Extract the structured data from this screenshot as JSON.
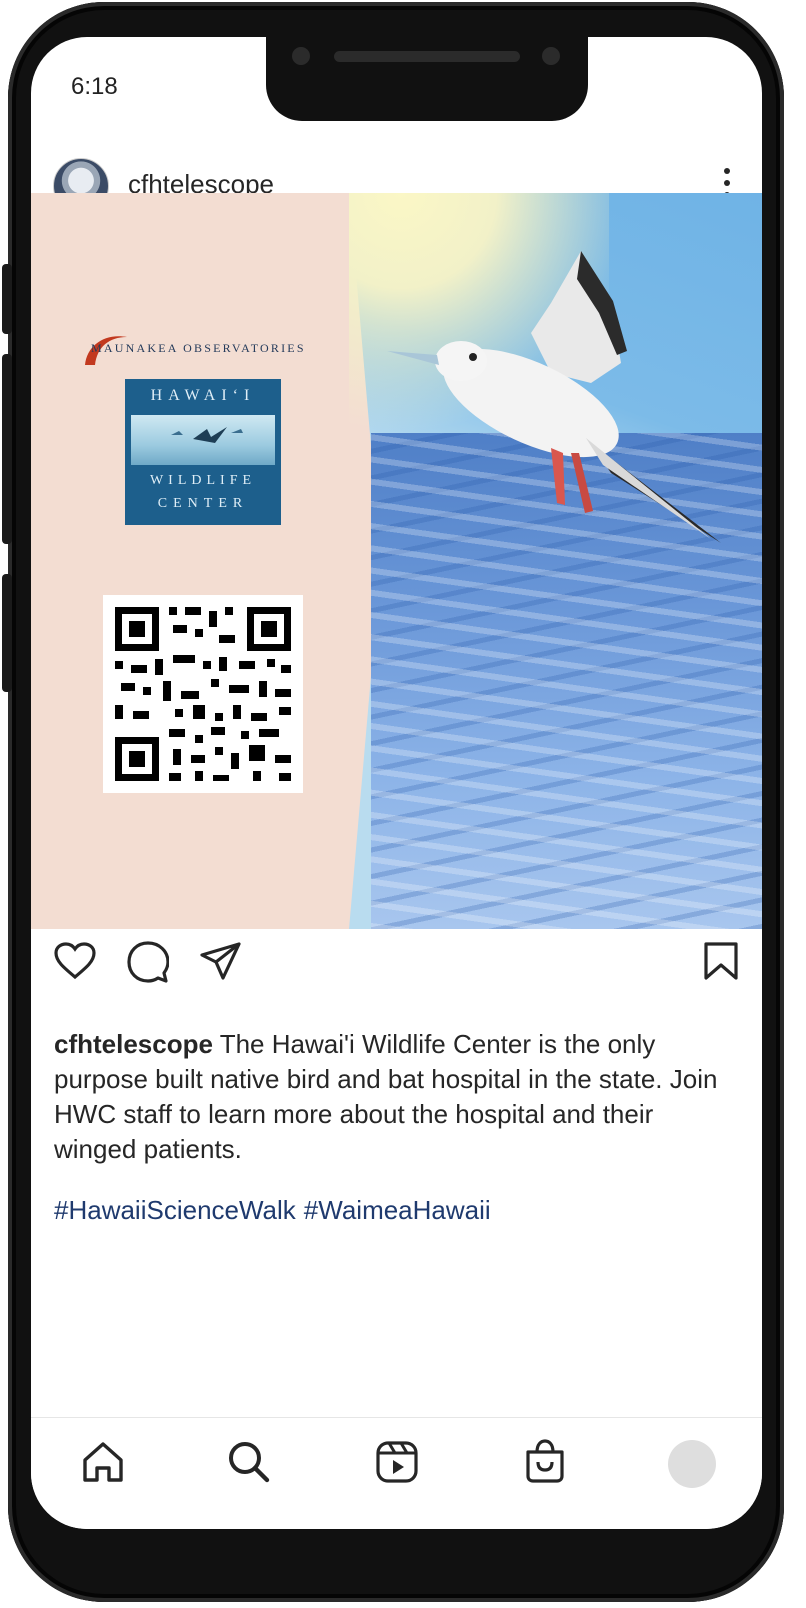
{
  "status_bar": {
    "time": "6:18"
  },
  "post": {
    "username": "cfhtelescope",
    "image": {
      "mko_logo_text": "MAUNAKEA OBSERVATORIES",
      "hwc_logo": {
        "line1": "HAWAI‘I",
        "line2": "WILDLIFE",
        "line3": "CENTER"
      }
    },
    "caption": {
      "username": "cfhtelescope",
      "text": "The Hawai'i Wildlife Center is the only purpose built native bird and bat hospital in the state. Join HWC staff to learn more about the hospital and their winged patients."
    },
    "hashtags": [
      "#HawaiiScienceWalk",
      "#WaimeaHawaii"
    ]
  },
  "actions": [
    "heart-icon",
    "comment-icon",
    "share-icon",
    "bookmark-icon"
  ],
  "tab_bar": [
    "home-icon",
    "search-icon",
    "reels-icon",
    "shop-icon",
    "profile-avatar"
  ],
  "colors": {
    "hashtag": "#1f3a6e",
    "text": "#262626",
    "left_panel": "#f3ddd2"
  }
}
